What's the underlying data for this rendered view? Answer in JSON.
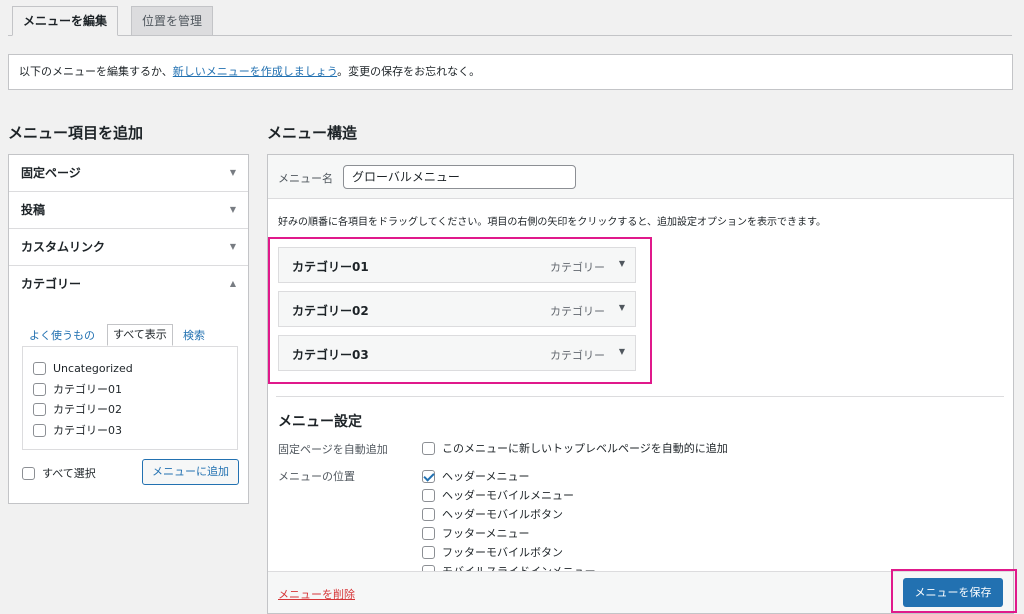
{
  "tabs": {
    "edit": "メニューを編集",
    "manage": "位置を管理"
  },
  "notice": {
    "before": "以下のメニューを編集するか、",
    "link": "新しいメニューを作成しましょう",
    "after": "。変更の保存をお忘れなく。"
  },
  "left": {
    "title": "メニュー項目を追加",
    "sections": [
      "固定ページ",
      "投稿",
      "カスタムリンク",
      "カテゴリー"
    ],
    "subtabs": {
      "recent": "よく使うもの",
      "all": "すべて表示",
      "search": "検索"
    },
    "categories": [
      "Uncategorized",
      "カテゴリー01",
      "カテゴリー02",
      "カテゴリー03"
    ],
    "select_all": "すべて選択",
    "add_button": "メニューに追加"
  },
  "right": {
    "title": "メニュー構造",
    "name_label": "メニュー名",
    "name_value": "グローバルメニュー",
    "instruction": "好みの順番に各項目をドラッグしてください。項目の右側の矢印をクリックすると、追加設定オプションを表示できます。",
    "items": [
      {
        "title": "カテゴリー01",
        "type": "カテゴリー"
      },
      {
        "title": "カテゴリー02",
        "type": "カテゴリー"
      },
      {
        "title": "カテゴリー03",
        "type": "カテゴリー"
      }
    ],
    "settings_title": "メニュー設定",
    "auto_add_label": "固定ページを自動追加",
    "auto_add_option": "このメニューに新しいトップレベルページを自動的に追加",
    "location_label": "メニューの位置",
    "locations": [
      {
        "label": "ヘッダーメニュー",
        "checked": true
      },
      {
        "label": "ヘッダーモバイルメニュー",
        "checked": false
      },
      {
        "label": "ヘッダーモバイルボタン",
        "checked": false
      },
      {
        "label": "フッターメニュー",
        "checked": false
      },
      {
        "label": "フッターモバイルボタン",
        "checked": false
      },
      {
        "label": "モバイルスライドインメニュー",
        "checked": false
      }
    ],
    "delete_link": "メニューを削除",
    "save_button": "メニューを保存"
  }
}
